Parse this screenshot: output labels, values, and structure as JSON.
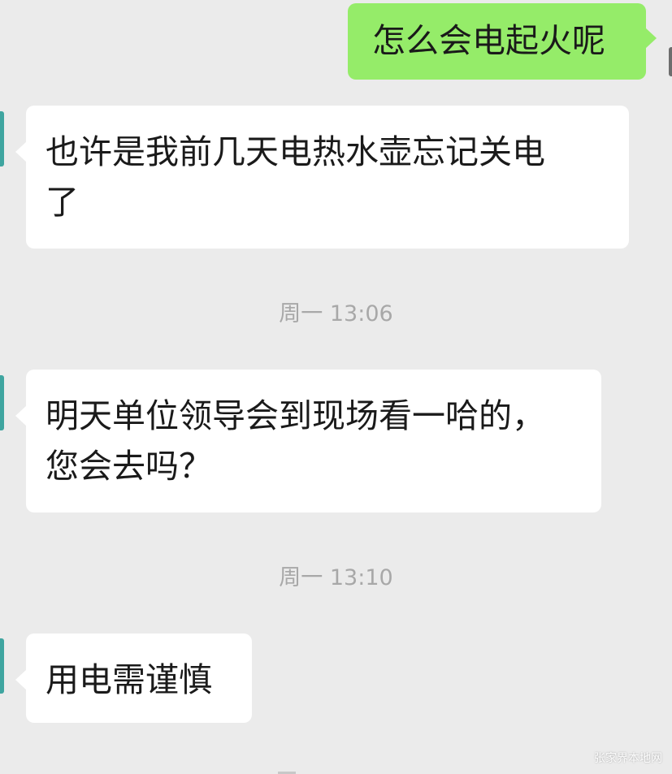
{
  "messages": [
    {
      "direction": "out",
      "text": "怎么会电起火呢"
    },
    {
      "direction": "in",
      "text": "也许是我前几天电热水壶忘记关电\n了"
    },
    {
      "type": "time",
      "text": "周一 13:06"
    },
    {
      "direction": "in",
      "text": "明天单位领导会到现场看一哈的，\n您会去吗？"
    },
    {
      "type": "time",
      "text": "周一 13:10"
    },
    {
      "direction": "in",
      "text": "用电需谨慎"
    }
  ],
  "watermark": "张家界本地网",
  "colors": {
    "background": "#ebebeb",
    "outgoing_bubble": "#95ec69",
    "incoming_bubble": "#ffffff",
    "timestamp_text": "#a8a8a8"
  }
}
